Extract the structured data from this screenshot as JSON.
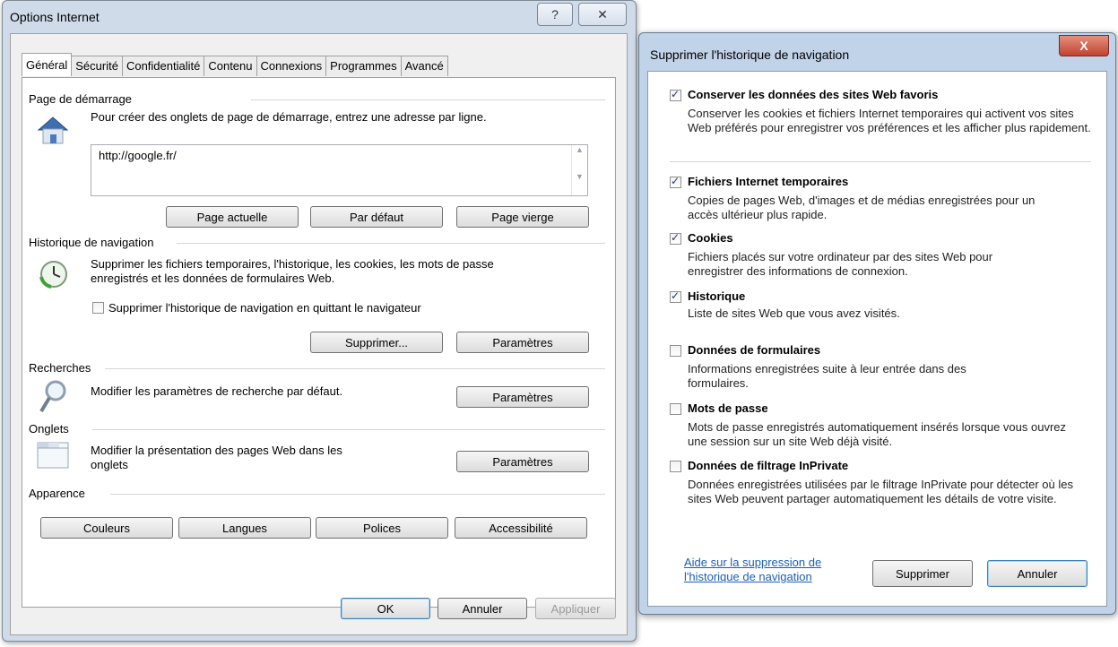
{
  "left_window": {
    "title": "Options Internet",
    "help_label": "?",
    "close_label": "✕",
    "tabs": [
      "Général",
      "Sécurité",
      "Confidentialité",
      "Contenu",
      "Connexions",
      "Programmes",
      "Avancé"
    ],
    "startpage": {
      "group": "Page de démarrage",
      "desc": "Pour créer des onglets de page de démarrage, entrez une adresse par ligne.",
      "url_value": "http://google.fr/",
      "btn_current": "Page actuelle",
      "btn_default": "Par défaut",
      "btn_blank": "Page vierge"
    },
    "history": {
      "group": "Historique de navigation",
      "desc": "Supprimer les fichiers temporaires, l'historique, les cookies, les mots de passe enregistrés et les données de formulaires Web.",
      "checkbox_label": "Supprimer l'historique de navigation en quittant le navigateur",
      "checkbox_checked": false,
      "btn_delete": "Supprimer...",
      "btn_settings": "Paramètres"
    },
    "search": {
      "group": "Recherches",
      "desc": "Modifier les paramètres de recherche par défaut.",
      "btn_settings": "Paramètres"
    },
    "tabs_section": {
      "group": "Onglets",
      "desc": "Modifier la présentation des pages Web dans les onglets",
      "btn_settings": "Paramètres"
    },
    "appearance": {
      "group": "Apparence",
      "btn_colors": "Couleurs",
      "btn_languages": "Langues",
      "btn_fonts": "Polices",
      "btn_accessibility": "Accessibilité"
    },
    "footer": {
      "ok": "OK",
      "cancel": "Annuler",
      "apply": "Appliquer"
    }
  },
  "right_window": {
    "title": "Supprimer l'historique de navigation",
    "close_label": "X",
    "options": [
      {
        "label": "Conserver les données des sites Web favoris",
        "desc": "Conserver les cookies et fichiers Internet temporaires qui activent vos sites Web préférés pour enregistrer vos préférences et les afficher plus rapidement.",
        "checked": true
      },
      {
        "label": "Fichiers Internet temporaires",
        "desc": "Copies de pages Web, d'images et de médias enregistrées pour un accès ultérieur plus rapide.",
        "checked": true
      },
      {
        "label": "Cookies",
        "desc": "Fichiers placés sur votre ordinateur par des sites Web pour enregistrer des informations de connexion.",
        "checked": true
      },
      {
        "label": "Historique",
        "desc": "Liste de sites Web que vous avez visités.",
        "checked": true
      },
      {
        "label": "Données de formulaires",
        "desc": "Informations enregistrées suite à leur entrée dans des formulaires.",
        "checked": false
      },
      {
        "label": "Mots de passe",
        "desc": "Mots de passe enregistrés automatiquement insérés lorsque vous ouvrez une session sur un site Web déjà visité.",
        "checked": false
      },
      {
        "label": "Données de filtrage InPrivate",
        "desc": "Données enregistrées utilisées par le filtrage InPrivate pour détecter où les sites Web peuvent partager automatiquement les détails de votre visite.",
        "checked": false
      }
    ],
    "help_link": "Aide sur la suppression de l'historique de navigation",
    "btn_delete": "Supprimer",
    "btn_cancel": "Annuler"
  }
}
